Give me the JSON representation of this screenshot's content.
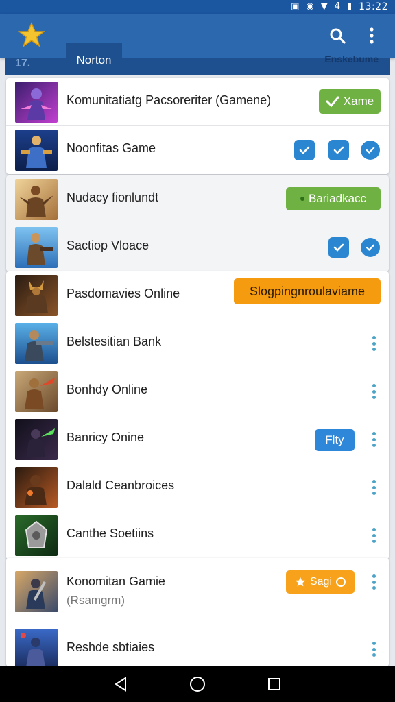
{
  "status_bar": {
    "time": "13:22",
    "signal_text": "4"
  },
  "app_bar": {
    "tab_name": "Norton",
    "tab_left_text": "17.",
    "tab_right_text": "Enskebume"
  },
  "sections": [
    {
      "rows": [
        {
          "title": "Komunitatiatg Pacsoreriter (Gamene)",
          "control": "chip",
          "chip_label": "Xame",
          "chip_icon": "check-icon"
        },
        {
          "title": "Noonfitas Game",
          "control": "checks"
        }
      ]
    },
    {
      "rows": [
        {
          "title": "Nudacy fionlundt",
          "control": "chip",
          "chip_label": "Bariadkacc"
        },
        {
          "title": "Sactiop Vloace",
          "control": "checks"
        }
      ]
    },
    {
      "rows": [
        {
          "title": "Pasdomavies Online",
          "control": "chip",
          "chip_label": "Slogpingnroulaviame"
        },
        {
          "title": "Belstesitian Bank",
          "control": "menu"
        },
        {
          "title": "Bonhdy Online",
          "control": "menu"
        },
        {
          "title": "Banricy Onine",
          "control": "chip+menu",
          "chip_label": "Flty"
        },
        {
          "title": "Dalald Ceanbroices",
          "control": "menu"
        },
        {
          "title": "Canthe Soetiins",
          "control": "menu"
        }
      ]
    },
    {
      "rows": [
        {
          "title": "Konomitan Gamie",
          "subtitle": "(Rsamgrm)",
          "control": "chip+menu",
          "chip_label": "Sagi"
        },
        {
          "title": "Reshde sbtiaies",
          "control": "menu"
        }
      ]
    }
  ],
  "colors": {
    "app_bar": "#2c68ad",
    "status_bar": "#1b56a0",
    "green_chip": "#70b144",
    "orange_chip": "#f59b10",
    "blue_accent": "#2a86d1",
    "menu_dots": "#4da3c8"
  },
  "icons": [
    "star-logo-icon",
    "search-icon",
    "overflow-menu-icon",
    "check-icon",
    "kebab-menu-icon",
    "back-icon",
    "home-icon",
    "recents-icon"
  ]
}
